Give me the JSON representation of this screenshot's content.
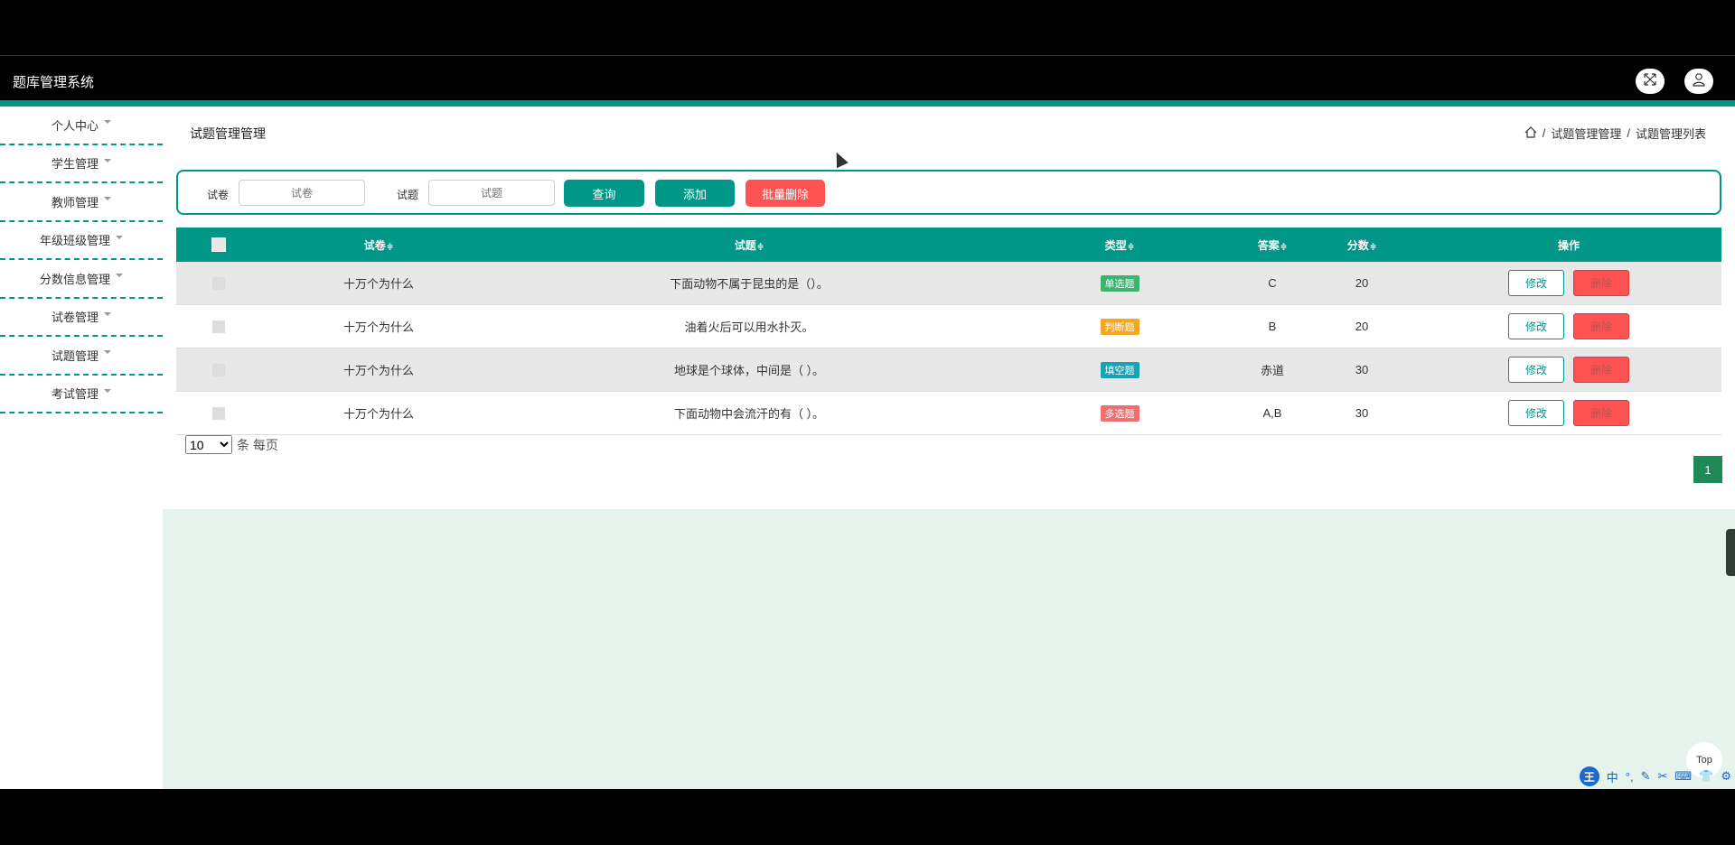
{
  "app": {
    "title": "题库管理系统"
  },
  "header": {
    "fullscreen_icon": "expand-icon",
    "user_icon": "user-icon"
  },
  "sidebar": {
    "items": [
      {
        "label": "个人中心"
      },
      {
        "label": "学生管理"
      },
      {
        "label": "教师管理"
      },
      {
        "label": "年级班级管理"
      },
      {
        "label": "分数信息管理"
      },
      {
        "label": "试卷管理"
      },
      {
        "label": "试题管理"
      },
      {
        "label": "考试管理"
      }
    ]
  },
  "page": {
    "title": "试题管理管理",
    "breadcrumb": [
      "试题管理管理",
      "试题管理列表"
    ],
    "separator": "/"
  },
  "search": {
    "paper_label": "试卷",
    "paper_placeholder": "试卷",
    "question_label": "试题",
    "question_placeholder": "试题",
    "query_button": "查询",
    "add_button": "添加",
    "batch_delete_button": "批量删除"
  },
  "table": {
    "headers": {
      "paper": "试卷",
      "question": "试题",
      "type": "类型",
      "answer": "答案",
      "score": "分数",
      "op": "操作"
    },
    "sort_glyph": "≑",
    "rows": [
      {
        "paper": "十万个为什么",
        "question": "下面动物不属于昆虫的是（）。",
        "type": "单选题",
        "type_color": "#3cb371",
        "answer": "C",
        "score": "20"
      },
      {
        "paper": "十万个为什么",
        "question": "油着火后可以用水扑灭。",
        "type": "判断题",
        "type_color": "#f5a623",
        "answer": "B",
        "score": "20"
      },
      {
        "paper": "十万个为什么",
        "question": "地球是个球体，中间是（ ）。",
        "type": "填空题",
        "type_color": "#17a2b8",
        "answer": "赤道",
        "score": "30"
      },
      {
        "paper": "十万个为什么",
        "question": "下面动物中会流汗的有（ ）。",
        "type": "多选题",
        "type_color": "#ef6f6f",
        "answer": "A,B",
        "score": "30"
      }
    ],
    "edit_label": "修改",
    "delete_label": "删除"
  },
  "pager": {
    "size_value": "10",
    "size_suffix": "条 每页",
    "current_page": "1"
  },
  "misc": {
    "top_label": "Top"
  },
  "ime": {
    "logo": "王",
    "items": [
      "中",
      "°,",
      "✎",
      "✂",
      "⌨",
      "👕",
      "⚙"
    ]
  }
}
